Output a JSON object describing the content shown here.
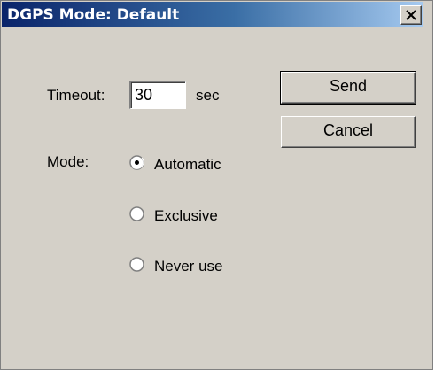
{
  "window": {
    "title": "DGPS Mode: Default"
  },
  "timeout": {
    "label": "Timeout:",
    "value": "30",
    "unit": "sec"
  },
  "mode": {
    "label": "Mode:",
    "options": [
      {
        "label": "Automatic",
        "selected": true
      },
      {
        "label": "Exclusive",
        "selected": false
      },
      {
        "label": "Never use",
        "selected": false
      }
    ]
  },
  "buttons": {
    "send": "Send",
    "cancel": "Cancel"
  },
  "icons": {
    "close": "close-icon",
    "radio": "radio-button-icon"
  },
  "colors": {
    "titlebar_start": "#0a246a",
    "titlebar_end": "#a6caf0",
    "dialog_face": "#d4d0c8"
  }
}
